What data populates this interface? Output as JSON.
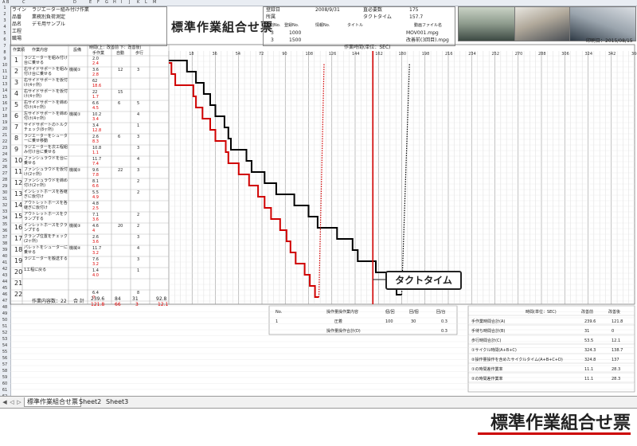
{
  "column_letters": [
    "A",
    "B",
    "C",
    "D",
    "E",
    "F",
    "G",
    "H",
    "I",
    "J",
    "K",
    "L",
    "M"
  ],
  "header": {
    "line_label": "ライン",
    "line_value": "ラジエーター組み付け作業",
    "item_label": "品番",
    "item_value": "業務別負荷測定",
    "name_label": "品名",
    "name_value": "デモ用サンプル",
    "process_label": "工程",
    "dept_label": "職場",
    "title": "標準作業組合せ票",
    "date_label": "登録日",
    "date_value": "2008/9/31",
    "place_label": "所属",
    "demand_label": "直必要数",
    "demand_value": "175",
    "takt_label": "タクトタイム",
    "takt_value": "157.7",
    "split_label": "分割No.",
    "reg_label": "登録No.",
    "info_label": "情報No.",
    "doc_title_label": "タイトル",
    "video_label": "動画ファイル名",
    "row1_split": "3",
    "row1_reg": "1000",
    "row1_video": "MOV001.mpg",
    "row2_split": "3",
    "row2_reg": "1500",
    "row2_video": "改善前(3回目).mpg",
    "print_date": "印刷日：2015/08/15"
  },
  "table_head": {
    "no": "作業順",
    "content": "作業内容",
    "equip": "設備",
    "time_group": "時間(上：改善前 下：改善後)",
    "manual": "手作業",
    "auto": "自動",
    "walk": "歩行",
    "chart_title": "作業時間(単位：SEC)"
  },
  "time_axis": [
    "18",
    "36",
    "54",
    "72",
    "90",
    "108",
    "126",
    "144",
    "162",
    "180",
    "198",
    "216",
    "234",
    "252",
    "270",
    "288",
    "306",
    "324",
    "342",
    "360"
  ],
  "steps": [
    {
      "no": "1",
      "text": "ラジエーターを組み付け台に乗せる",
      "equip": "",
      "v1": "2.0",
      "v2": "2.4",
      "a": "",
      "w": ""
    },
    {
      "no": "2",
      "text": "右サイドサポートを組み付け台に乗せる",
      "equip": "機械①",
      "v1": "3.6",
      "v2": "2.8",
      "a": "12",
      "w": "3"
    },
    {
      "no": "3",
      "text": "右サイドサポートを仮付け(4ヶ所)",
      "equip": "",
      "v1": "62",
      "v2": "18.6",
      "a": "",
      "w": ""
    },
    {
      "no": "4",
      "text": "右サイドサポートを仮付け(4ヶ所)",
      "equip": "",
      "v1": "22",
      "v2": "1.7",
      "a": "15",
      "w": ""
    },
    {
      "no": "5",
      "text": "右サイドサポートを締め付け(4ヶ所)",
      "equip": "",
      "v1": "6.6",
      "v2": "4.5",
      "a": "6",
      "w": "5"
    },
    {
      "no": "6",
      "text": "左サイドサポートを締め付け(4ヶ所)",
      "equip": "機械①",
      "v1": "10.2",
      "v2": "3.4",
      "a": "",
      "w": "4"
    },
    {
      "no": "7",
      "text": "サイドサポートのトルクチェック(8ヶ所)",
      "equip": "",
      "v1": "3.4",
      "v2": "12.8",
      "a": "",
      "w": "1"
    },
    {
      "no": "8",
      "text": "ラジエーターをシューターに乗せ移動",
      "equip": "",
      "v1": "2.6",
      "v2": "8.3",
      "a": "6",
      "w": "3"
    },
    {
      "no": "9",
      "text": "ラジエーターを次工程組み付け台に乗せる",
      "equip": "",
      "v1": "10.8",
      "v2": "1.1",
      "a": "",
      "w": "3"
    },
    {
      "no": "10",
      "text": "ファンシュラウドを台に乗せる",
      "equip": "",
      "v1": "11.7",
      "v2": "7.4",
      "a": "",
      "w": "4"
    },
    {
      "no": "11",
      "text": "ファンシュラウドを仮付け(2ヶ所)",
      "equip": "機械②",
      "v1": "9.6",
      "v2": "7.8",
      "a": "22",
      "w": "3"
    },
    {
      "no": "12",
      "text": "ファンシュラウドを締め付け(2ヶ所)",
      "equip": "",
      "v1": "8.1",
      "v2": "6.6",
      "a": "",
      "w": "2"
    },
    {
      "no": "13",
      "text": "インレットホースを各継ぎに仮付け",
      "equip": "",
      "v1": "5.5",
      "v2": "4.9",
      "a": "",
      "w": "2"
    },
    {
      "no": "14",
      "text": "アウトレットホースを各継ぎに仮付け",
      "equip": "",
      "v1": "4.8",
      "v2": "2.5",
      "a": "",
      "w": ""
    },
    {
      "no": "15",
      "text": "アウトレットホースをクランプする",
      "equip": "",
      "v1": "7.1",
      "v2": "3.6",
      "a": "",
      "w": "2"
    },
    {
      "no": "16",
      "text": "インレットホースをクランプする",
      "equip": "機械③",
      "v1": "4.6",
      "v2": "4",
      "a": "20",
      "w": "2"
    },
    {
      "no": "17",
      "text": "クランプ位置をチェック(2ヶ所)",
      "equip": "",
      "v1": "2.6",
      "v2": "3.6",
      "a": "",
      "w": "3"
    },
    {
      "no": "18",
      "text": "パレットをシューターに乗せる",
      "equip": "機械④",
      "v1": "11.7",
      "v2": "3.2",
      "a": "",
      "w": "4"
    },
    {
      "no": "19",
      "text": "ラジエーターを搬送する",
      "equip": "",
      "v1": "7.6",
      "v2": "3.2",
      "a": "",
      "w": "3"
    },
    {
      "no": "20",
      "text": "1工程に戻る",
      "equip": "",
      "v1": "1.4",
      "v2": "4.0",
      "a": "",
      "w": "1"
    },
    {
      "no": "21",
      "text": "",
      "equip": "",
      "v1": "",
      "v2": "",
      "a": "",
      "w": ""
    },
    {
      "no": "22",
      "text": "",
      "equip": "",
      "v1": "6.4",
      "v2": "0",
      "a": "",
      "w": "8"
    }
  ],
  "totals": {
    "label": "作業内容数：22",
    "sum_label": "合 計",
    "manual_before": "239.6",
    "manual_after": "121.8",
    "auto_before": "84",
    "auto_after": "66",
    "walk_before": "31",
    "walk_after": "3",
    "total_before": "92.8",
    "total_after": "12.1"
  },
  "summary_table": {
    "no_h": "No.",
    "content_h": "操作量操作業内容",
    "per_h": "個/回",
    "freq_h": "回/個",
    "val_h": "回/台",
    "row_no": "1",
    "row_content": "圧着",
    "row_per": "100",
    "row_freq": "30",
    "row_val": "0.3",
    "sub_label": "操作量操作合計(D)",
    "sub_val": "0.3"
  },
  "right_table": {
    "header": "時間(単位：SEC)",
    "col_before": "改善前",
    "col_after": "改善後",
    "rows": [
      {
        "label": "手作業時間合計(A)",
        "before": "239.6",
        "after": "121.8"
      },
      {
        "label": "手待ち時間合計(B)",
        "before": "31",
        "after": "0"
      },
      {
        "label": "歩行時間合計(C)",
        "before": "53.5",
        "after": "12.1"
      },
      {
        "label": "①サイクル時間(A+B+C)",
        "before": "324.3",
        "after": "138.7"
      },
      {
        "label": "②操作量操作を含めたサイクルタイム(A+B+C+D)",
        "before": "324.8",
        "after": "137"
      },
      {
        "label": "①の時間差作業率",
        "before": "11.1",
        "after": "28.3"
      },
      {
        "label": "②の時間差作業率",
        "before": "11.1",
        "after": "28.3"
      }
    ]
  },
  "chart_data": {
    "type": "line",
    "xlabel": "作業時間(単位：SEC)",
    "x_ticks": [
      18,
      36,
      54,
      72,
      90,
      108,
      126,
      144,
      162,
      180,
      198,
      216,
      234,
      252,
      270,
      288,
      306,
      324,
      342,
      360
    ],
    "xlim": [
      0,
      360
    ],
    "takt_time": 157.7,
    "takt_label": "タクトタイム",
    "series": [
      {
        "name": "改善前",
        "color": "#000000",
        "steps": [
          [
            0,
            14
          ],
          [
            14,
            21
          ],
          [
            21,
            27
          ],
          [
            27,
            32
          ],
          [
            32,
            36
          ],
          [
            36,
            43
          ],
          [
            43,
            46
          ],
          [
            46,
            48
          ],
          [
            48,
            60
          ],
          [
            60,
            64
          ],
          [
            64,
            74
          ],
          [
            74,
            83
          ],
          [
            83,
            97
          ],
          [
            97,
            108
          ],
          [
            108,
            115
          ],
          [
            115,
            130
          ],
          [
            130,
            142
          ],
          [
            142,
            146
          ],
          [
            146,
            160
          ],
          [
            160,
            170
          ],
          [
            170,
            176
          ],
          [
            176,
            180
          ]
        ]
      },
      {
        "name": "改善後",
        "color": "#d00000",
        "steps": [
          [
            0,
            2
          ],
          [
            2,
            5
          ],
          [
            5,
            19
          ],
          [
            19,
            21
          ],
          [
            21,
            26
          ],
          [
            26,
            32
          ],
          [
            32,
            36
          ],
          [
            36,
            44
          ],
          [
            44,
            46
          ],
          [
            46,
            54
          ],
          [
            54,
            62
          ],
          [
            62,
            69
          ],
          [
            69,
            74
          ],
          [
            74,
            79
          ],
          [
            79,
            86
          ],
          [
            86,
            91
          ],
          [
            91,
            94
          ],
          [
            94,
            98
          ],
          [
            98,
            105
          ],
          [
            105,
            109
          ],
          [
            109,
            113
          ],
          [
            113,
            116
          ]
        ]
      }
    ]
  },
  "sheet_tabs": [
    "標準作業組合せ票",
    "Sheet2",
    "Sheet3"
  ],
  "caption": "標準作業組合せ票",
  "colors": {
    "before": "#000000",
    "after": "#d00000",
    "takt": "#d00000",
    "grid": "#c9c9c9"
  }
}
